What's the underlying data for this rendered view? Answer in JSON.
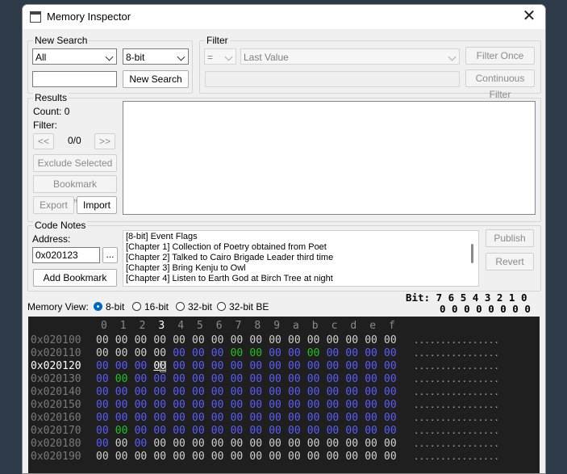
{
  "window": {
    "title": "Memory Inspector",
    "close_glyph": "✕"
  },
  "new_search": {
    "label": "New Search",
    "scope_value": "All",
    "size_value": "8-bit",
    "search_value": "",
    "button_label": "New Search"
  },
  "filter": {
    "label": "Filter",
    "op_value": "=",
    "mode_value": "Last Value",
    "value": "",
    "filter_once_label": "Filter Once",
    "continuous_label": "Continuous Filter"
  },
  "results": {
    "label": "Results",
    "count_text": "Count:  0",
    "filter_text": "Filter:",
    "prev_label": "<<",
    "page_text": "0/0",
    "next_label": ">>",
    "exclude_label": "Exclude Selected",
    "bookmark_label": "Bookmark Selected",
    "export_label": "Export",
    "import_label": "Import"
  },
  "code_notes": {
    "label": "Code Notes",
    "address_label": "Address:",
    "address_value": "0x020123",
    "browse_label": "...",
    "add_bookmark_label": "Add Bookmark",
    "publish_label": "Publish",
    "revert_label": "Revert",
    "notes": [
      "[8-bit] Event Flags",
      "[Chapter 1] Collection of Poetry obtained from Poet",
      "[Chapter 2] Talked to Cairo Brigade Leader third time",
      "[Chapter 3] Bring Kenju to Owl",
      "[Chapter 4] Listen to Earth God at Birch Tree at night"
    ]
  },
  "memory_view": {
    "label": "Memory View:",
    "options": [
      "8-bit",
      "16-bit",
      "32-bit",
      "32-bit BE"
    ],
    "selected": "8-bit",
    "bit_header": "Bit: 7 6 5 4 3 2 1 0",
    "bit_values": "0 0 0 0 0 0 0 0",
    "column_header": [
      "0",
      "1",
      "2",
      "3",
      "4",
      "5",
      "6",
      "7",
      "8",
      "9",
      "a",
      "b",
      "c",
      "d",
      "e",
      "f"
    ],
    "selected_column": "3",
    "selected_address": "0x020120",
    "colors": {
      "zero": "#d0d0d0",
      "blue": "#5b5bff",
      "green": "#22c022",
      "address": "#7a7a7a",
      "selected": "#ffffff"
    },
    "rows": [
      {
        "address": "0x020100",
        "bytes": [
          "00",
          "00",
          "00",
          "00",
          "00",
          "00",
          "00",
          "00",
          "00",
          "00",
          "00",
          "00",
          "00",
          "00",
          "00",
          "00"
        ],
        "kinds": [
          "z",
          "z",
          "z",
          "z",
          "z",
          "z",
          "z",
          "z",
          "z",
          "z",
          "z",
          "z",
          "z",
          "z",
          "z",
          "z"
        ],
        "ascii": "................"
      },
      {
        "address": "0x020110",
        "bytes": [
          "00",
          "00",
          "00",
          "00",
          "00",
          "00",
          "00",
          "00",
          "00",
          "00",
          "00",
          "00",
          "00",
          "00",
          "00",
          "00"
        ],
        "kinds": [
          "z",
          "z",
          "z",
          "z",
          "b",
          "b",
          "b",
          "g",
          "g",
          "b",
          "b",
          "g",
          "b",
          "b",
          "b",
          "b"
        ],
        "ascii": "................"
      },
      {
        "address": "0x020120",
        "bytes": [
          "00",
          "00",
          "00",
          "00",
          "00",
          "00",
          "00",
          "00",
          "00",
          "00",
          "00",
          "00",
          "00",
          "00",
          "00",
          "00"
        ],
        "kinds": [
          "b",
          "b",
          "b",
          "s",
          "b",
          "b",
          "b",
          "b",
          "b",
          "b",
          "b",
          "b",
          "b",
          "b",
          "b",
          "b"
        ],
        "ascii": "................"
      },
      {
        "address": "0x020130",
        "bytes": [
          "00",
          "00",
          "00",
          "00",
          "00",
          "00",
          "00",
          "00",
          "00",
          "00",
          "00",
          "00",
          "00",
          "00",
          "00",
          "00"
        ],
        "kinds": [
          "b",
          "g",
          "b",
          "b",
          "b",
          "b",
          "b",
          "b",
          "b",
          "b",
          "b",
          "b",
          "b",
          "b",
          "b",
          "b"
        ],
        "ascii": "................"
      },
      {
        "address": "0x020140",
        "bytes": [
          "00",
          "00",
          "00",
          "00",
          "00",
          "00",
          "00",
          "00",
          "00",
          "00",
          "00",
          "00",
          "00",
          "00",
          "00",
          "00"
        ],
        "kinds": [
          "b",
          "b",
          "b",
          "b",
          "b",
          "b",
          "b",
          "b",
          "b",
          "b",
          "b",
          "b",
          "b",
          "b",
          "b",
          "b"
        ],
        "ascii": "................"
      },
      {
        "address": "0x020150",
        "bytes": [
          "00",
          "00",
          "00",
          "00",
          "00",
          "00",
          "00",
          "00",
          "00",
          "00",
          "00",
          "00",
          "00",
          "00",
          "00",
          "00"
        ],
        "kinds": [
          "b",
          "b",
          "b",
          "b",
          "b",
          "b",
          "b",
          "b",
          "b",
          "b",
          "b",
          "b",
          "b",
          "b",
          "b",
          "b"
        ],
        "ascii": "................"
      },
      {
        "address": "0x020160",
        "bytes": [
          "00",
          "00",
          "00",
          "00",
          "00",
          "00",
          "00",
          "00",
          "00",
          "00",
          "00",
          "00",
          "00",
          "00",
          "00",
          "00"
        ],
        "kinds": [
          "b",
          "b",
          "b",
          "b",
          "b",
          "b",
          "b",
          "b",
          "b",
          "b",
          "b",
          "b",
          "b",
          "b",
          "b",
          "b"
        ],
        "ascii": "................"
      },
      {
        "address": "0x020170",
        "bytes": [
          "00",
          "00",
          "00",
          "00",
          "00",
          "00",
          "00",
          "00",
          "00",
          "00",
          "00",
          "00",
          "00",
          "00",
          "00",
          "00"
        ],
        "kinds": [
          "b",
          "g",
          "b",
          "b",
          "b",
          "b",
          "b",
          "b",
          "b",
          "b",
          "b",
          "b",
          "b",
          "b",
          "b",
          "b"
        ],
        "ascii": "................"
      },
      {
        "address": "0x020180",
        "bytes": [
          "00",
          "00",
          "00",
          "00",
          "00",
          "00",
          "00",
          "00",
          "00",
          "00",
          "00",
          "00",
          "00",
          "00",
          "00",
          "00"
        ],
        "kinds": [
          "b",
          "z",
          "b",
          "z",
          "z",
          "z",
          "z",
          "z",
          "z",
          "z",
          "z",
          "z",
          "z",
          "z",
          "z",
          "z"
        ],
        "ascii": "................"
      },
      {
        "address": "0x020190",
        "bytes": [
          "00",
          "00",
          "00",
          "00",
          "00",
          "00",
          "00",
          "00",
          "00",
          "00",
          "00",
          "00",
          "00",
          "00",
          "00",
          "00"
        ],
        "kinds": [
          "z",
          "z",
          "z",
          "z",
          "z",
          "z",
          "z",
          "z",
          "z",
          "z",
          "z",
          "z",
          "z",
          "z",
          "z",
          "z"
        ],
        "ascii": "................"
      }
    ]
  }
}
